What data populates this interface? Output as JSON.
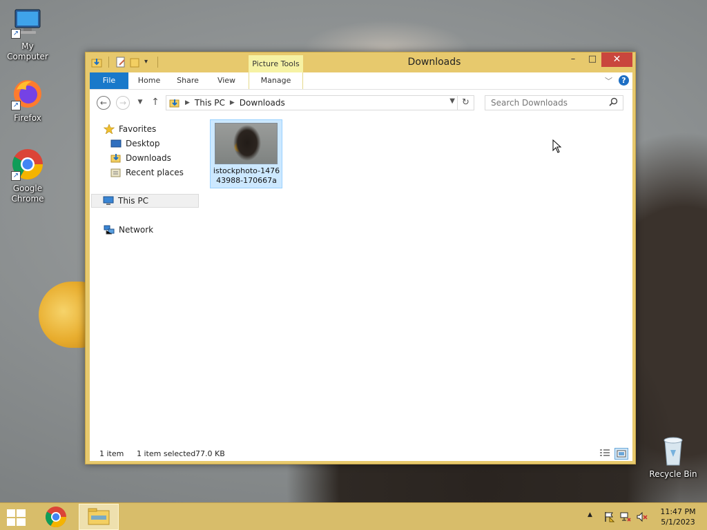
{
  "desktop": {
    "icons": [
      {
        "label": "My Computer"
      },
      {
        "label": "Firefox"
      },
      {
        "label": "Google Chrome"
      },
      {
        "label": "Recycle Bin"
      }
    ]
  },
  "window": {
    "title": "Downloads",
    "contextual_tab": "Picture Tools",
    "caption": {
      "minimize": "–",
      "maximize": "□",
      "close": "✕"
    },
    "ribbon_tabs": [
      {
        "label": "File"
      },
      {
        "label": "Home"
      },
      {
        "label": "Share"
      },
      {
        "label": "View"
      },
      {
        "label": "Manage"
      }
    ],
    "help": "?",
    "address": {
      "breadcrumbs": [
        "This PC",
        "Downloads"
      ]
    },
    "search": {
      "placeholder": "Search Downloads"
    },
    "navigation": {
      "favorites": {
        "label": "Favorites",
        "items": [
          {
            "label": "Desktop"
          },
          {
            "label": "Downloads"
          },
          {
            "label": "Recent places"
          }
        ]
      },
      "this_pc": {
        "label": "This PC"
      },
      "network": {
        "label": "Network"
      }
    },
    "files": [
      {
        "name": "istockphoto-147643988-170667a"
      }
    ],
    "status": {
      "count": "1 item",
      "selected": "1 item selected",
      "size": "77.0 KB"
    }
  },
  "taskbar": {
    "clock": {
      "time": "11:47 PM",
      "date": "5/1/2023"
    }
  },
  "colors": {
    "window_frame": "#e7c96d",
    "file_tab": "#1979ca",
    "close_button": "#c9463d",
    "selection": "#cce8ff"
  }
}
